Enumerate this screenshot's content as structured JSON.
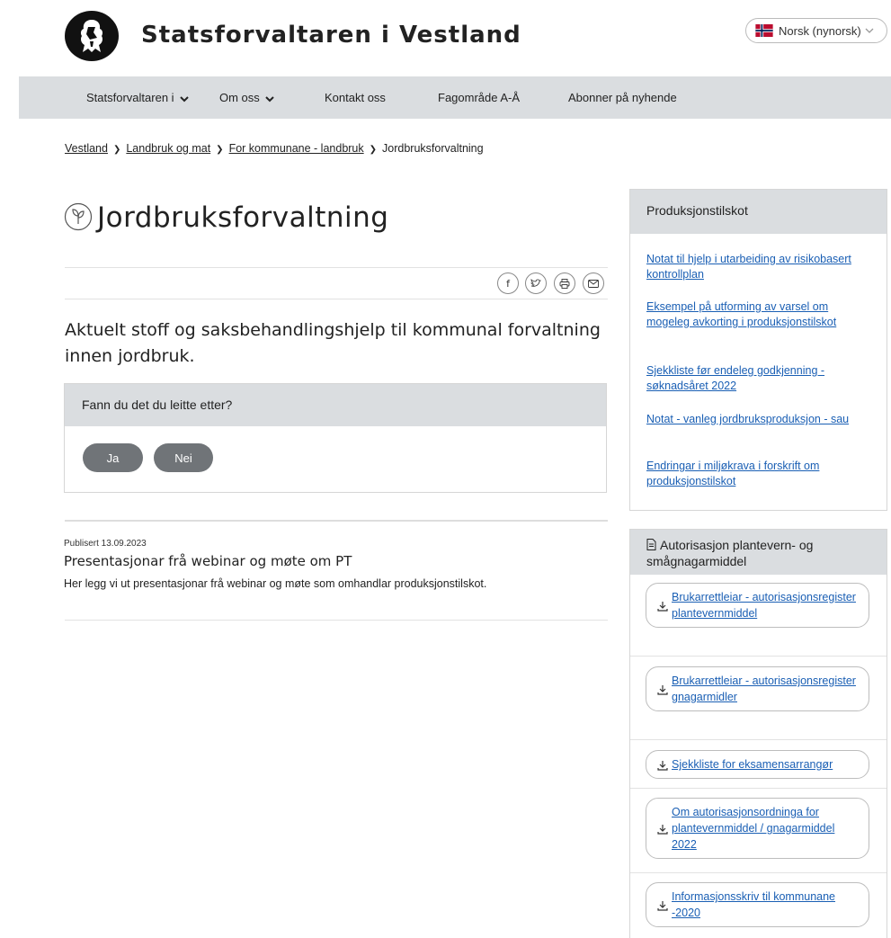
{
  "header": {
    "site_title": "Statsforvaltaren i Vestland",
    "language": "Norsk (nynorsk)"
  },
  "nav": {
    "items": [
      {
        "label": "Statsforvaltaren i",
        "has_dropdown": true
      },
      {
        "label": "Om oss",
        "has_dropdown": true
      },
      {
        "label": "Kontakt oss",
        "has_dropdown": false
      },
      {
        "label": "Fagområde A-Å",
        "has_dropdown": false
      },
      {
        "label": "Abonner på nyhende",
        "has_dropdown": false
      }
    ]
  },
  "breadcrumb": {
    "items": [
      "Vestland",
      "Landbruk og mat",
      "For kommunane - landbruk",
      "Jordbruksforvaltning"
    ]
  },
  "page": {
    "title": "Jordbruksforvaltning",
    "lead": "Aktuelt stoff og saksbehandlingshjelp til kommunal forvaltning innen jordbruk."
  },
  "feedback": {
    "question": "Fann du det du leitte etter?",
    "yes": "Ja",
    "no": "Nei"
  },
  "news": {
    "published": "Publisert 13.09.2023",
    "title": "Presentasjonar frå webinar og møte om PT",
    "description": "Her legg vi ut presentasjonar frå webinar og møte som omhandlar produksjonstilskot."
  },
  "sidebar": {
    "box1": {
      "title": "Produksjonstilskot",
      "links": [
        "Notat til hjelp i utarbeiding av risikobasert kontrollplan",
        "Eksempel på utforming av varsel om mogeleg avkorting i produksjonstilskot",
        "Sjekkliste før endeleg godkjenning - søknadsåret 2022",
        "Notat - vanleg jordbruksproduksjon - sau",
        "Endringar i miljøkrava i forskrift om produksjonstilskot"
      ]
    },
    "box2": {
      "title": "Autorisasjon plantevern- og smågnagarmiddel",
      "downloads": [
        "Brukarrettleiar - autorisasjonsregister plantevernmiddel",
        "Brukarrettleiar - autorisasjonsregister gnagarmidler",
        "Sjekkliste for eksamensarrangør",
        "Om autorisasjonsordninga for plantevernmiddel / gnagarmiddel 2022",
        "Informasjonsskriv til kommunane -2020"
      ]
    }
  },
  "colors": {
    "nav_bg": "#dadde0",
    "link": "#1a5fb4",
    "button_bg": "#707478"
  }
}
